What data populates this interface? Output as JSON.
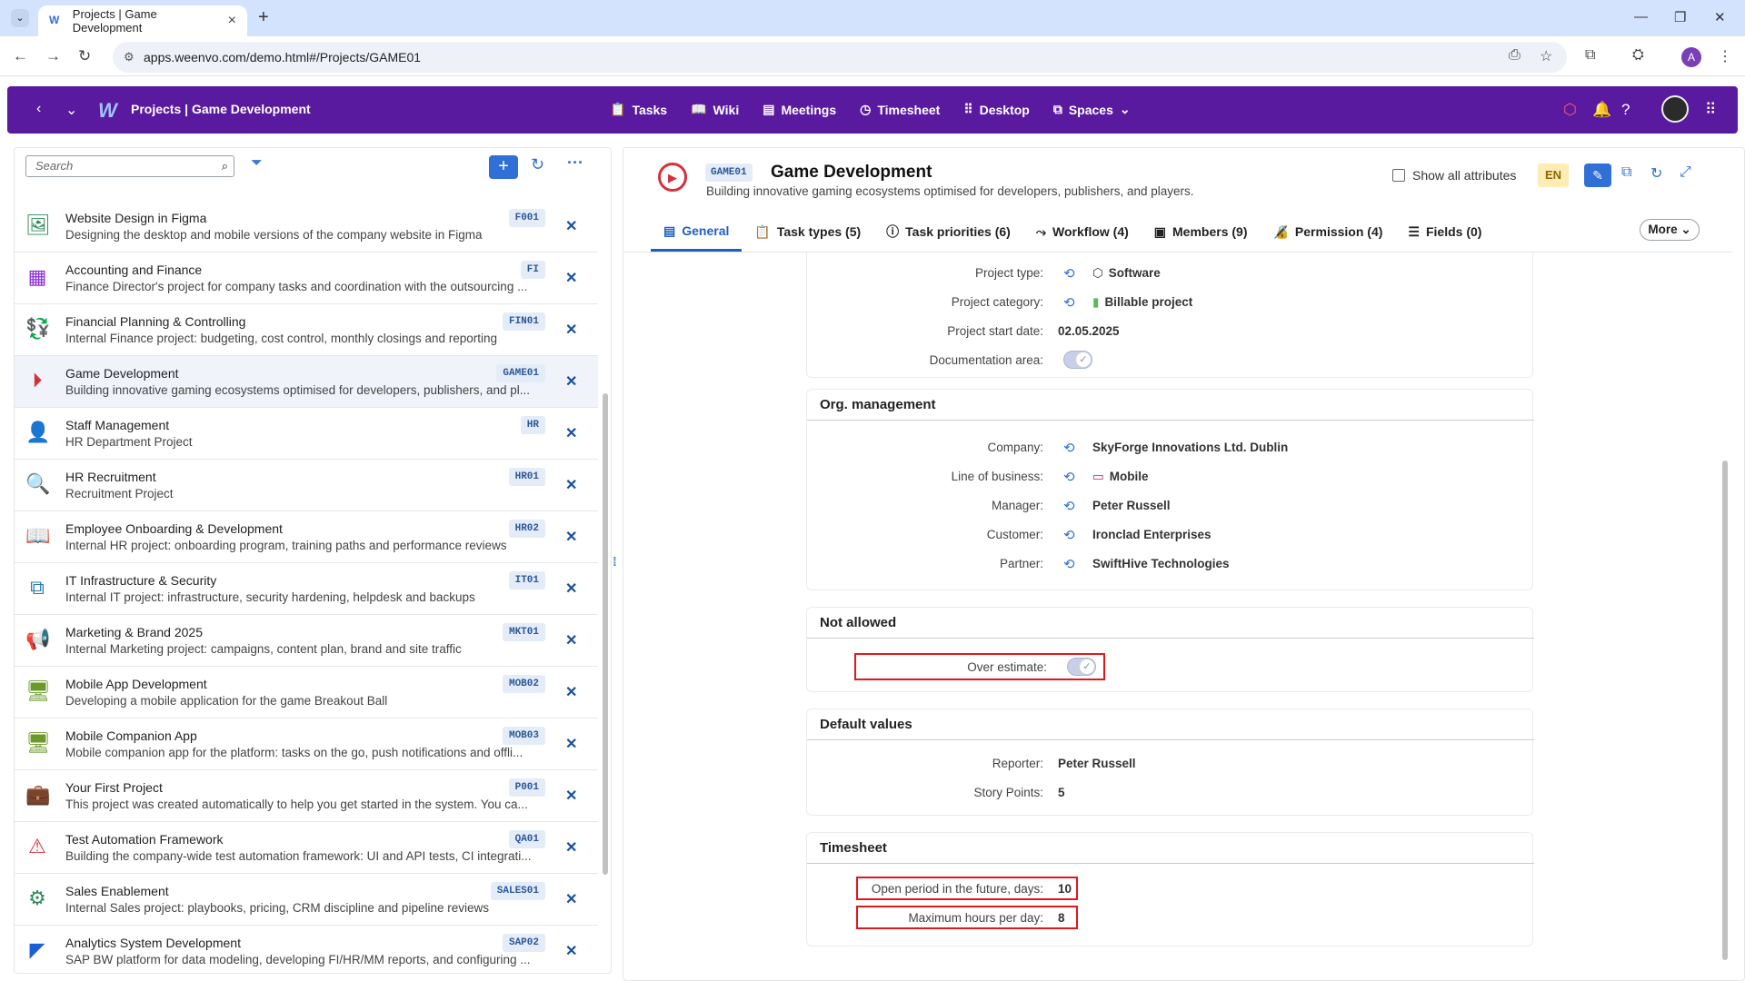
{
  "browser": {
    "tab_title": "Projects | Game Development",
    "url": "apps.weenvo.com/demo.html#/Projects/GAME01",
    "profile_initial": "A"
  },
  "app": {
    "title": "Projects | Game Development",
    "nav": [
      {
        "label": "Tasks",
        "icon": "clipboard-icon"
      },
      {
        "label": "Wiki",
        "icon": "book-icon"
      },
      {
        "label": "Meetings",
        "icon": "meetings-icon"
      },
      {
        "label": "Timesheet",
        "icon": "timesheet-icon"
      },
      {
        "label": "Desktop",
        "icon": "grid-icon"
      },
      {
        "label": "Spaces",
        "icon": "spaces-icon"
      }
    ]
  },
  "sidebar": {
    "search_placeholder": "Search",
    "projects": [
      {
        "name": "Website Design in Figma",
        "desc": "Designing the desktop and mobile versions of the company website in Figma",
        "code": "F001",
        "icon": "image-icon",
        "color": "#2e8b57"
      },
      {
        "name": "Accounting and Finance",
        "desc": "Finance Director's project for company tasks and coordination with the outsourcing ...",
        "code": "FI",
        "icon": "finance-icon",
        "color": "#8a2be2"
      },
      {
        "name": "Financial Planning & Controlling",
        "desc": "Internal Finance project: budgeting, cost control, monthly closings and reporting",
        "code": "FIN01",
        "icon": "planning-icon",
        "color": "#8a2be2"
      },
      {
        "name": "Game Development",
        "desc": "Building innovative gaming ecosystems optimised for developers, publishers, and pl...",
        "code": "GAME01",
        "icon": "play-icon",
        "color": "#d6303b"
      },
      {
        "name": "Staff Management",
        "desc": "HR Department Project",
        "code": "HR",
        "icon": "staff-icon",
        "color": "#c77a1a"
      },
      {
        "name": "HR Recruitment",
        "desc": "Recruitment Project",
        "code": "HR01",
        "icon": "recruit-icon",
        "color": "#2e8b57"
      },
      {
        "name": "Employee Onboarding & Development",
        "desc": "Internal HR project: onboarding program, training paths and performance reviews",
        "code": "HR02",
        "icon": "onboarding-icon",
        "color": "#c77a1a"
      },
      {
        "name": "IT Infrastructure & Security",
        "desc": "Internal IT project: infrastructure, security hardening, helpdesk and backups",
        "code": "IT01",
        "icon": "it-icon",
        "color": "#2a7aa8"
      },
      {
        "name": "Marketing & Brand 2025",
        "desc": "Internal Marketing project: campaigns, content plan, brand and site traffic",
        "code": "MKT01",
        "icon": "megaphone-icon",
        "color": "#d04aa8"
      },
      {
        "name": "Mobile App Development",
        "desc": "Developing a mobile application for the game Breakout Ball",
        "code": "MOB02",
        "icon": "mobile-icon",
        "color": "#6a9a2a"
      },
      {
        "name": "Mobile Companion App",
        "desc": "Mobile companion app for the platform: tasks on the go, push notifications and offli...",
        "code": "MOB03",
        "icon": "mobile-icon",
        "color": "#6a9a2a"
      },
      {
        "name": "Your First Project",
        "desc": "This project was created automatically to help you get started in the system. You ca...",
        "code": "P001",
        "icon": "briefcase-icon",
        "color": "#2f5fbf"
      },
      {
        "name": "Test Automation Framework",
        "desc": "Building the company-wide test automation framework: UI and API tests, CI integrati...",
        "code": "QA01",
        "icon": "test-icon",
        "color": "#d6303b"
      },
      {
        "name": "Sales Enablement",
        "desc": "Internal Sales project: playbooks, pricing, CRM discipline and pipeline reviews",
        "code": "SALES01",
        "icon": "sales-icon",
        "color": "#2e8b57"
      },
      {
        "name": "Analytics System Development",
        "desc": "SAP BW platform for data modeling, developing FI/HR/MM reports, and configuring ...",
        "code": "SAP02",
        "icon": "sap-icon",
        "color": "#1a5fd6"
      }
    ]
  },
  "detail": {
    "code": "GAME01",
    "title": "Game Development",
    "subtitle": "Building innovative gaming ecosystems optimised for developers, publishers, and players.",
    "show_all_label": "Show all attributes",
    "lang": "EN",
    "tabs": [
      {
        "label": "General"
      },
      {
        "label": "Task types (5)"
      },
      {
        "label": "Task priorities (6)"
      },
      {
        "label": "Workflow (4)"
      },
      {
        "label": "Members (9)"
      },
      {
        "label": "Permission (4)"
      },
      {
        "label": "Fields (0)"
      }
    ],
    "more_label": "More",
    "general": {
      "project_type_label": "Project type:",
      "project_type": "Software",
      "project_category_label": "Project category:",
      "project_category": "Billable project",
      "start_date_label": "Project start date:",
      "start_date": "02.05.2025",
      "doc_area_label": "Documentation area:"
    },
    "org": {
      "title": "Org. management",
      "company_label": "Company:",
      "company": "SkyForge Innovations Ltd. Dublin",
      "lob_label": "Line of business:",
      "lob": "Mobile",
      "manager_label": "Manager:",
      "manager": "Peter Russell",
      "customer_label": "Customer:",
      "customer": "Ironclad Enterprises",
      "partner_label": "Partner:",
      "partner": "SwiftHive Technologies"
    },
    "not_allowed": {
      "title": "Not allowed",
      "over_estimate_label": "Over estimate:"
    },
    "defaults": {
      "title": "Default values",
      "reporter_label": "Reporter:",
      "reporter": "Peter Russell",
      "story_points_label": "Story Points:",
      "story_points": "5"
    },
    "timesheet": {
      "title": "Timesheet",
      "open_period_label": "Open period in the future, days:",
      "open_period": "10",
      "max_hours_label": "Maximum hours per day:",
      "max_hours": "8"
    }
  }
}
